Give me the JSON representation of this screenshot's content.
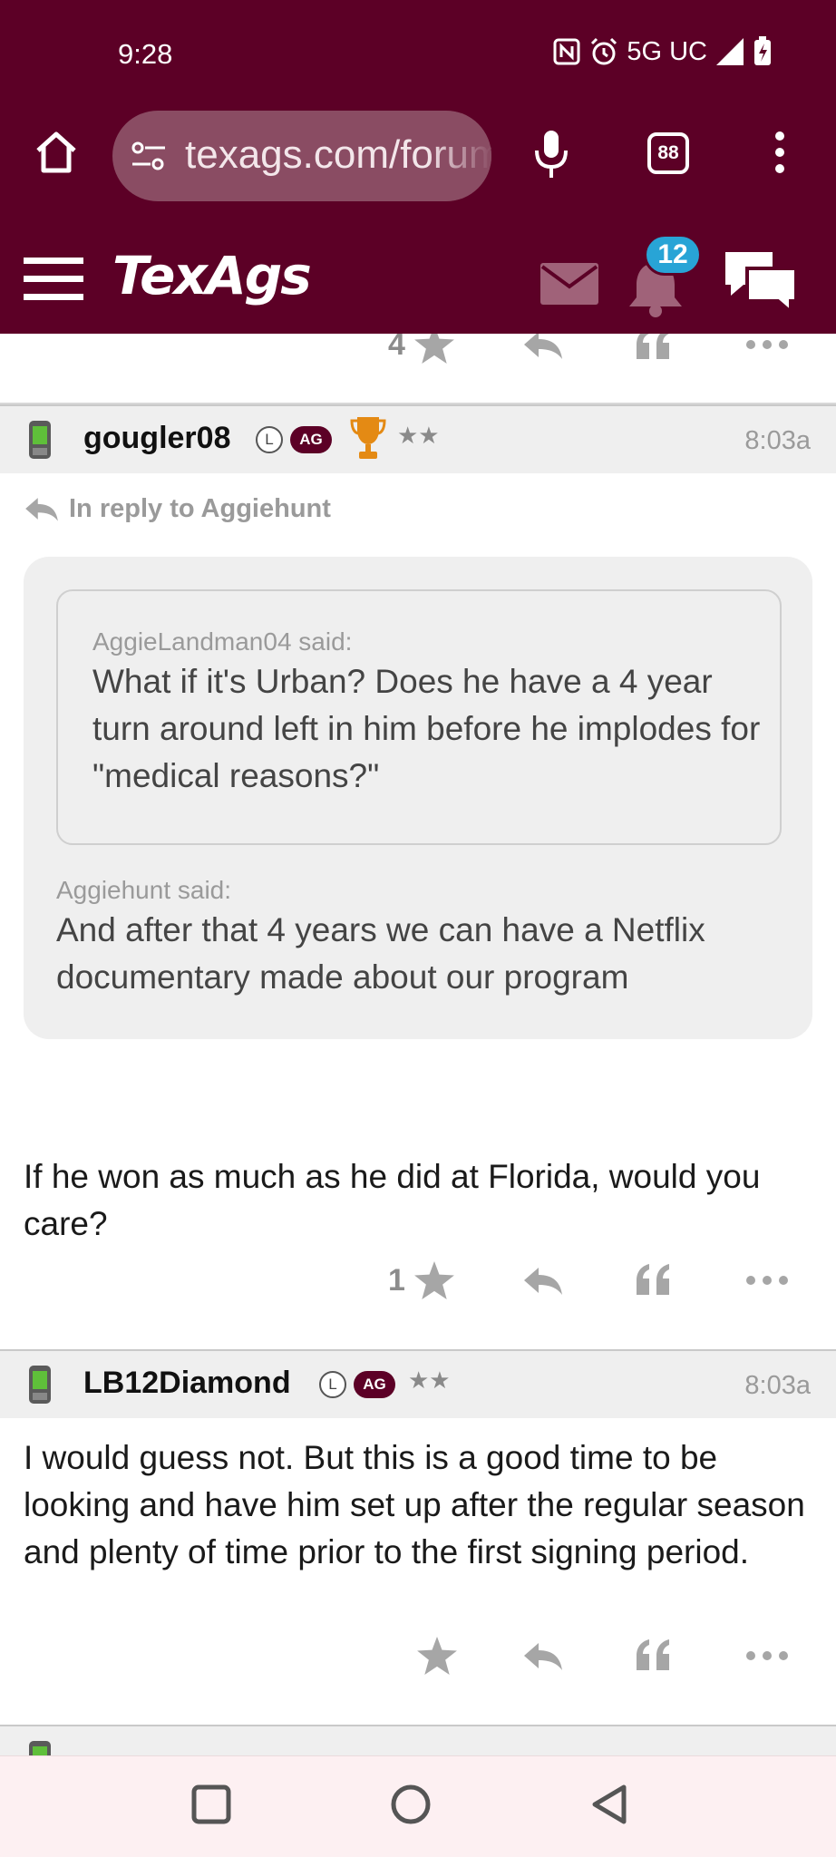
{
  "status_bar": {
    "time": "9:28",
    "network": "5G UC",
    "icons": [
      "nfc-icon",
      "alarm-icon",
      "signal-icon",
      "battery-charging-icon"
    ]
  },
  "browser": {
    "url": "texags.com/forums",
    "tab_count": "88",
    "icons": [
      "home-icon",
      "site-settings-icon",
      "mic-icon",
      "more-vert-icon"
    ]
  },
  "site_header": {
    "logo": "TexAgs",
    "notification_count": "12",
    "icons": [
      "hamburger-icon",
      "mail-icon",
      "bell-icon",
      "chat-icon"
    ]
  },
  "colors": {
    "maroon": "#5c0026",
    "badge_blue": "#28a4d6",
    "header_gray": "#efefef"
  },
  "posts": [
    {
      "username": "gougler08",
      "level_badge": "L",
      "affiliation_badge": "AG",
      "stars": "★★",
      "time": "8:03a",
      "reply_to": "In reply to Aggiehunt",
      "nested_quote": {
        "author": "AggieLandman04 said:",
        "text": "What if it's Urban? Does he have a 4 year turn around left in him before he implodes for \"medical reasons?\""
      },
      "quote": {
        "author": "Aggiehunt said:",
        "text": "And after that 4 years we can have a Netflix documentary made about our program"
      },
      "body": "If he won as much as he did at Florida, would you care?",
      "star_count": "1"
    },
    {
      "username": "LB12Diamond",
      "level_badge": "L",
      "affiliation_badge": "AG",
      "stars": "★★",
      "time": "8:03a",
      "body": "I would guess not. But this is a good time to be looking and have him set up after the regular season and plenty of time prior to the first signing period.",
      "star_count": ""
    }
  ],
  "previous_post": {
    "star_count": "4"
  },
  "nav": {
    "icons": [
      "recents-icon",
      "home-circle-icon",
      "back-icon"
    ]
  }
}
